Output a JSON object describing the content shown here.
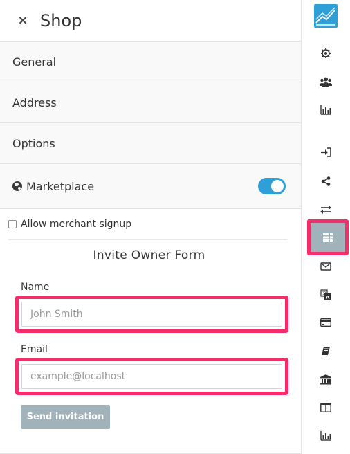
{
  "header": {
    "close_icon": "×",
    "title": "Shop"
  },
  "sections": {
    "general": "General",
    "address": "Address",
    "options": "Options",
    "marketplace": "Marketplace",
    "marketplace_enabled": true
  },
  "form": {
    "allow_signup_label": "Allow merchant signup",
    "allow_signup_checked": false,
    "title": "Invite Owner Form",
    "name_label": "Name",
    "name_placeholder": "John Smith",
    "email_label": "Email",
    "email_placeholder": "example@localhost",
    "send_label": "Send invitation"
  },
  "rail": {
    "items": [
      "settings-icon",
      "users-icon",
      "bar-chart-icon",
      "sign-in-icon",
      "share-icon",
      "exchange-icon",
      "grid-icon",
      "envelope-icon",
      "translate-icon",
      "credit-card-icon",
      "book-icon",
      "bank-icon",
      "columns-icon",
      "bar-chart-icon"
    ],
    "active": "grid-icon"
  },
  "colors": {
    "accent": "#2f9fd8",
    "highlight": "#f72d6b",
    "button": "#a2b2bb"
  }
}
